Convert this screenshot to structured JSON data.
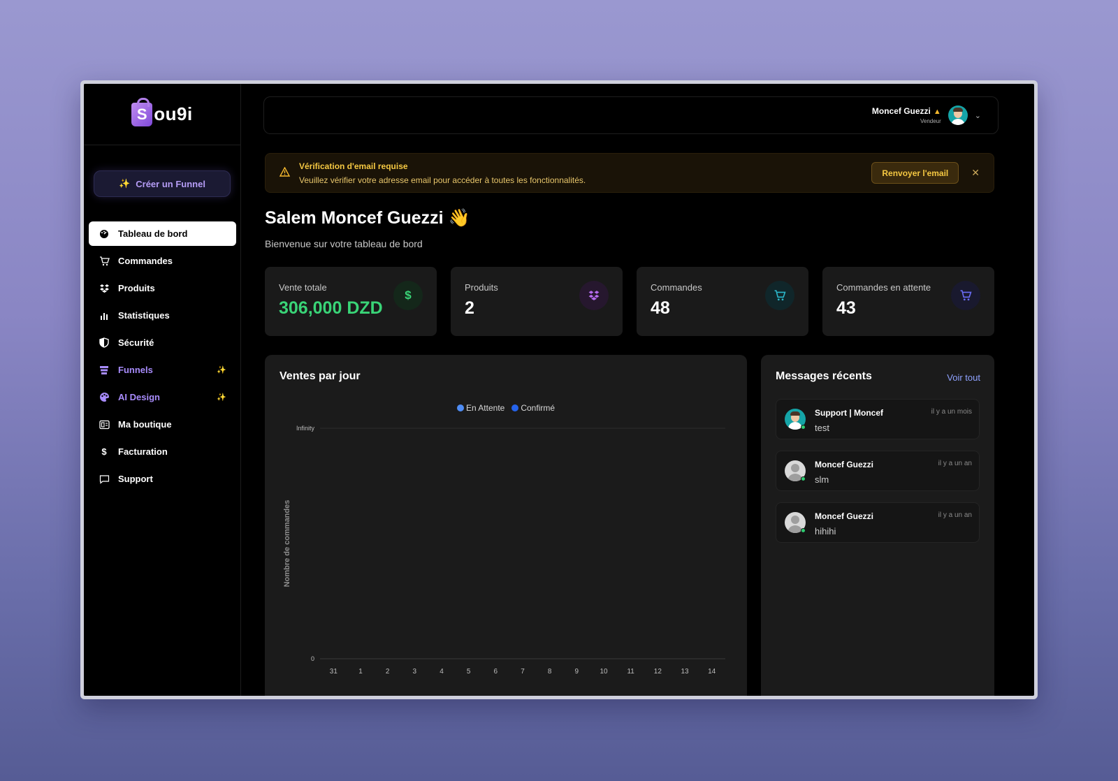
{
  "brand": {
    "logo_letter": "S",
    "logo_text": "ou9i"
  },
  "sidebar": {
    "create_button": "Créer un Funnel",
    "items": [
      {
        "label": "Tableau de bord",
        "icon": "gauge-icon",
        "active": true
      },
      {
        "label": "Commandes",
        "icon": "cart-icon"
      },
      {
        "label": "Produits",
        "icon": "boxes-icon"
      },
      {
        "label": "Statistiques",
        "icon": "bar-chart-icon"
      },
      {
        "label": "Sécurité",
        "icon": "shield-icon"
      },
      {
        "label": "Funnels",
        "icon": "funnel-icon",
        "highlight": true
      },
      {
        "label": "AI Design",
        "icon": "palette-icon",
        "highlight": true
      },
      {
        "label": "Ma boutique",
        "icon": "store-icon"
      },
      {
        "label": "Facturation",
        "icon": "dollar-icon"
      },
      {
        "label": "Support",
        "icon": "chat-icon"
      }
    ]
  },
  "header": {
    "user_name": "Moncef Guezzi",
    "user_role": "Vendeur"
  },
  "alert": {
    "title": "Vérification d'email requise",
    "message": "Veuillez vérifier votre adresse email pour accéder à toutes les fonctionnalités.",
    "action": "Renvoyer l'email"
  },
  "greeting": {
    "title": "Salem Moncef Guezzi 👋",
    "subtitle": "Bienvenue sur votre tableau de bord"
  },
  "stats": [
    {
      "label": "Vente totale",
      "value": "306,000 DZD",
      "icon": "dollar-icon",
      "color": "#39d477"
    },
    {
      "label": "Produits",
      "value": "2",
      "icon": "boxes-icon",
      "color": "#b66cf0"
    },
    {
      "label": "Commandes",
      "value": "48",
      "icon": "cart-icon",
      "color": "#2bb6c9"
    },
    {
      "label": "Commandes en attente",
      "value": "43",
      "icon": "cart-icon",
      "color": "#6a6cf5"
    }
  ],
  "chart_panel": {
    "title": "Ventes par jour"
  },
  "chart_data": {
    "type": "bar",
    "title": "",
    "xlabel": "",
    "ylabel": "Nombre de commandes",
    "categories": [
      "31",
      "1",
      "2",
      "3",
      "4",
      "5",
      "6",
      "7",
      "8",
      "9",
      "10",
      "11",
      "12",
      "13",
      "14"
    ],
    "y_ticks": [
      "Infinity",
      "0"
    ],
    "series": [
      {
        "name": "En Attente",
        "color": "#4f8df5",
        "values": [
          0,
          0,
          0,
          0,
          0,
          0,
          0,
          0,
          0,
          0,
          0,
          0,
          0,
          0,
          0
        ]
      },
      {
        "name": "Confirmé",
        "color": "#2563eb",
        "values": [
          0,
          0,
          0,
          0,
          0,
          0,
          0,
          0,
          0,
          0,
          0,
          0,
          0,
          0,
          0
        ]
      }
    ],
    "legend": "top-center",
    "grid": true
  },
  "messages": {
    "title": "Messages récents",
    "see_all": "Voir tout",
    "items": [
      {
        "name": "Support | Moncef",
        "text": "test",
        "time": "il y a un mois"
      },
      {
        "name": "Moncef Guezzi",
        "text": "slm",
        "time": "il y a un an"
      },
      {
        "name": "Moncef Guezzi",
        "text": "hihihi",
        "time": "il y a un an"
      }
    ]
  }
}
